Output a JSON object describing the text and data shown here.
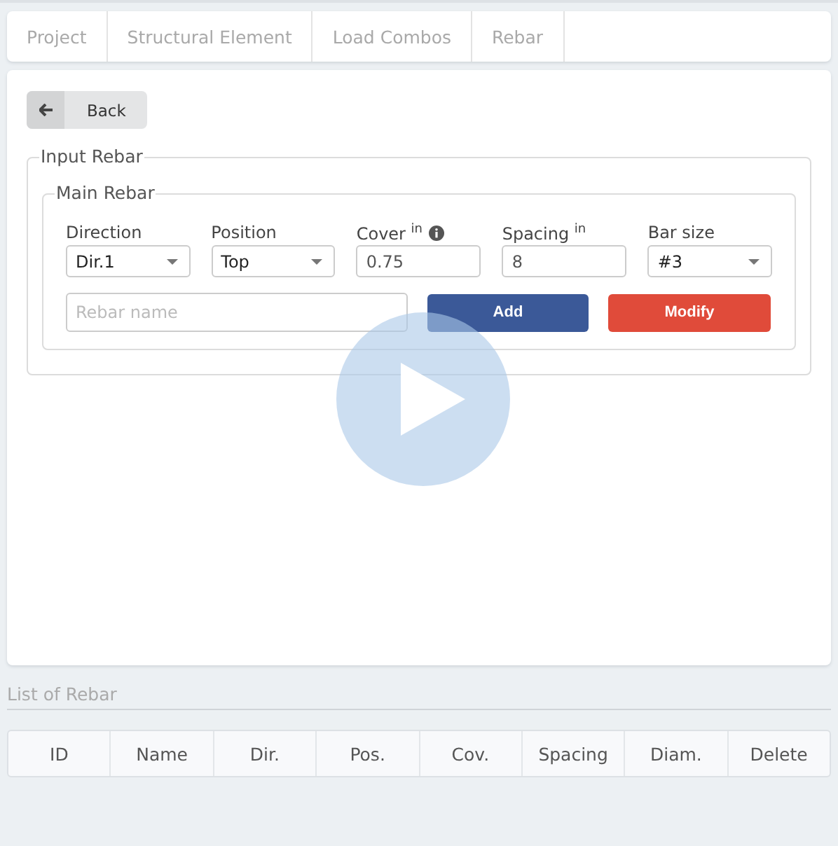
{
  "tabs": [
    {
      "label": "Project",
      "selected": false
    },
    {
      "label": "Structural Element",
      "selected": false
    },
    {
      "label": "Load Combos",
      "selected": false
    },
    {
      "label": "Rebar",
      "selected": false
    }
  ],
  "back_button": {
    "label": "Back"
  },
  "input_rebar": {
    "legend": "Input Rebar",
    "main_rebar": {
      "legend": "Main Rebar",
      "fields": [
        {
          "kind": "select",
          "label": "Direction",
          "value": "Dir.1"
        },
        {
          "kind": "select",
          "label": "Position",
          "value": "Top"
        },
        {
          "kind": "input",
          "label": "Cover $^{in}$",
          "info": true,
          "value": "0.75"
        },
        {
          "kind": "input",
          "label": "Spacing $^{in}$",
          "value": "8"
        },
        {
          "kind": "select",
          "label": "Bar size",
          "value": "#3"
        }
      ],
      "name_field": {
        "placeholder": "Rebar name"
      },
      "buttons": [
        {
          "kind": "primary",
          "label": "Add"
        },
        {
          "kind": "danger",
          "label": "Modify"
        }
      ]
    }
  },
  "list": {
    "title": "List of Rebar",
    "columns": [
      "ID",
      "Name",
      "Dir.",
      "Pos.",
      "Cov.",
      "Spacing",
      "Diam.",
      "Delete"
    ]
  }
}
